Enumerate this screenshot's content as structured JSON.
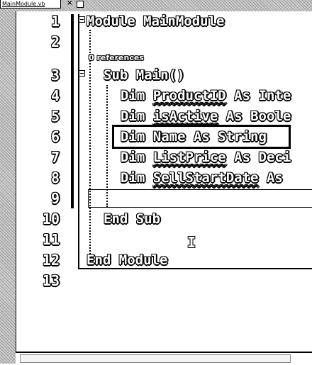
{
  "tab": {
    "filename": "MainModule.vb",
    "close_glyph": "×"
  },
  "editor": {
    "line_numbers": [
      "1",
      "2",
      "3",
      "4",
      "5",
      "6",
      "7",
      "8",
      "9",
      "10",
      "11",
      "12",
      "13"
    ],
    "codelens": "0 references",
    "lines": {
      "l1": "Module MainModule",
      "l3": "Sub Main()",
      "l4_kw": "Dim",
      "l4_id": "ProductID",
      "l4_rest": "As Inte",
      "l5_kw": "Dim",
      "l5_id": "isActive",
      "l5_rest": "As Boole",
      "l6": "Dim Name As String",
      "l7_kw": "Dim",
      "l7_id": "ListPrice",
      "l7_rest": "As Deci",
      "l8_kw": "Dim",
      "l8_id": "SellStartDate",
      "l8_rest": "As",
      "l10": "End Sub",
      "l12": "End Module"
    },
    "cursor_glyph": "I"
  }
}
